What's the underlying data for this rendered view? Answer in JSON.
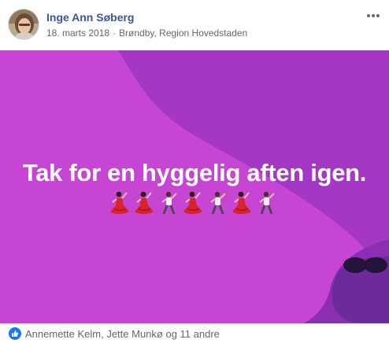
{
  "post": {
    "author": "Inge Ann Søberg",
    "date": "18. marts 2018",
    "location": "Brøndby, Region Hovedstaden",
    "text": "Tak for en hyggelig aften igen.",
    "emojis": [
      "flamenco-dancer-icon",
      "flamenco-dancer-icon",
      "man-dancing-icon",
      "flamenco-dancer-icon",
      "man-dancing-icon",
      "flamenco-dancer-icon",
      "man-dancing-icon"
    ],
    "reactions": "Annemette Kelm, Jette Munkø og 11 andre"
  },
  "colors": {
    "background": "#c646d3",
    "background_dark": "#9a2fb8",
    "author": "#385898",
    "like": "#1877f2",
    "text": "#ffffff"
  }
}
